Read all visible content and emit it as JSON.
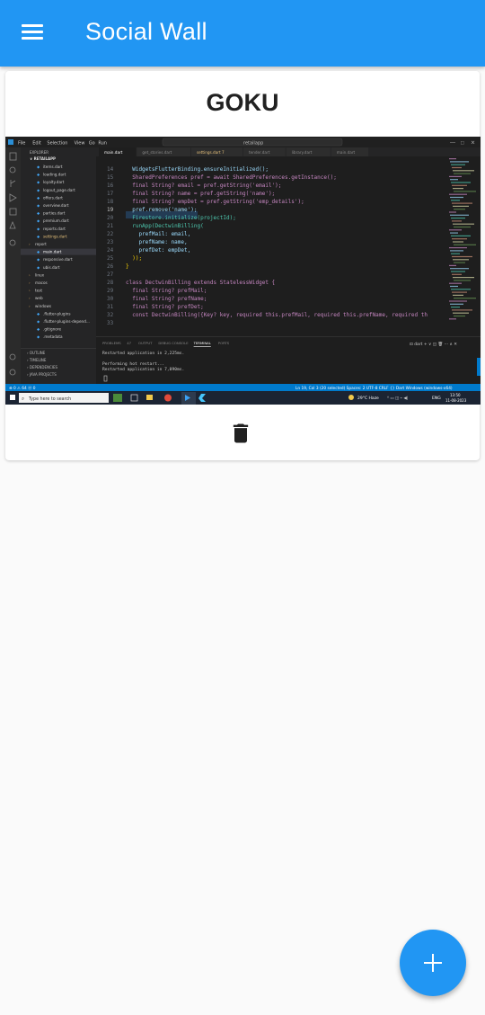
{
  "appbar": {
    "title": "Social Wall",
    "menu_icon": "menu-icon"
  },
  "post": {
    "author": "GOKU",
    "delete_icon": "delete-icon",
    "image": {
      "menubar": [
        "File",
        "Edit",
        "Selection",
        "View",
        "Go",
        "Run"
      ],
      "search": "retailapp",
      "tabs": [
        "main.dart",
        "get_stories.dart",
        "settings.dart 7",
        "tender.dart",
        "library.dart",
        "main.dart"
      ],
      "explorer_title": "EXPLORER",
      "project": "RETAILAPP",
      "files": [
        "items.dart",
        "loading.dart",
        "loyalty.dart",
        "logout_page.dart",
        "offers.dart",
        "overview.dart",
        "parties.dart",
        "premium.dart",
        "reports.dart",
        "settings.dart",
        "report",
        "main.dart",
        "responsive.dart",
        "ubis.dart",
        "linux",
        "macos",
        "test",
        "web",
        "windows",
        ".flutter-plugins",
        ".flutter-plugins-depend...",
        ".gitignore",
        ".metadata"
      ],
      "outline_sections": [
        "OUTLINE",
        "TIMELINE",
        "DEPENDENCIES",
        "JAVA PROJECTS"
      ],
      "breadcrumb": "lib > main.dart > ⓜ main",
      "code_lines": [
        {
          "n": "14",
          "t": "  WidgetsFlutterBinding.ensureInitialized();"
        },
        {
          "n": "15",
          "t": "  SharedPreferences pref = await SharedPreferences.getInstance();"
        },
        {
          "n": "16",
          "t": "  final String? email = pref.getString('email');"
        },
        {
          "n": "17",
          "t": "  final String? name = pref.getString('name');"
        },
        {
          "n": "18",
          "t": "  final String? empDet = pref.getString('emp_details');"
        },
        {
          "n": "19",
          "t": "  pref.remove('name');"
        },
        {
          "n": "20",
          "t": "  Firestore.initialize(projectId);"
        },
        {
          "n": "21",
          "t": "  runApp(DectwinBilling("
        },
        {
          "n": "22",
          "t": "    prefMail: email,"
        },
        {
          "n": "23",
          "t": "    prefName: name,"
        },
        {
          "n": "24",
          "t": "    prefDet: empDet,"
        },
        {
          "n": "25",
          "t": "  ));"
        },
        {
          "n": "26",
          "t": "}"
        },
        {
          "n": "27",
          "t": ""
        },
        {
          "n": "28",
          "t": "class DectwinBilling extends StatelessWidget {"
        },
        {
          "n": "29",
          "t": "  final String? prefMail;"
        },
        {
          "n": "30",
          "t": "  final String? prefName;"
        },
        {
          "n": "31",
          "t": "  final String? prefDet;"
        },
        {
          "n": "32",
          "t": "  const DectwinBilling({Key? key, required this.prefMail, required this.prefName, required th"
        },
        {
          "n": "33",
          "t": ""
        }
      ],
      "panel_tabs": [
        "PROBLEMS",
        "47",
        "OUTPUT",
        "DEBUG CONSOLE",
        "TERMINAL",
        "PORTS"
      ],
      "terminal_lines": [
        "Restarted application in 2,225ms.",
        "",
        "Performing hot restart...",
        "Restarted application in 7,090ms."
      ],
      "panel_right": "dart",
      "status_left": "⊗ 0 ⚠ 64   ⓦ 0",
      "status_right": "Ln 19, Col 3 (20 selected)   Spaces: 2   UTF-8   CRLF   {} Dart   Windows (windows-x64)",
      "taskbar_search": "Type here to search",
      "weather": "29°C Haze",
      "lang": "ENG",
      "time": "13:50",
      "date": "11-08-2023"
    }
  },
  "fab": {
    "icon": "add-icon"
  },
  "colors": {
    "primary": "#2196f3",
    "delete": "#212121"
  }
}
